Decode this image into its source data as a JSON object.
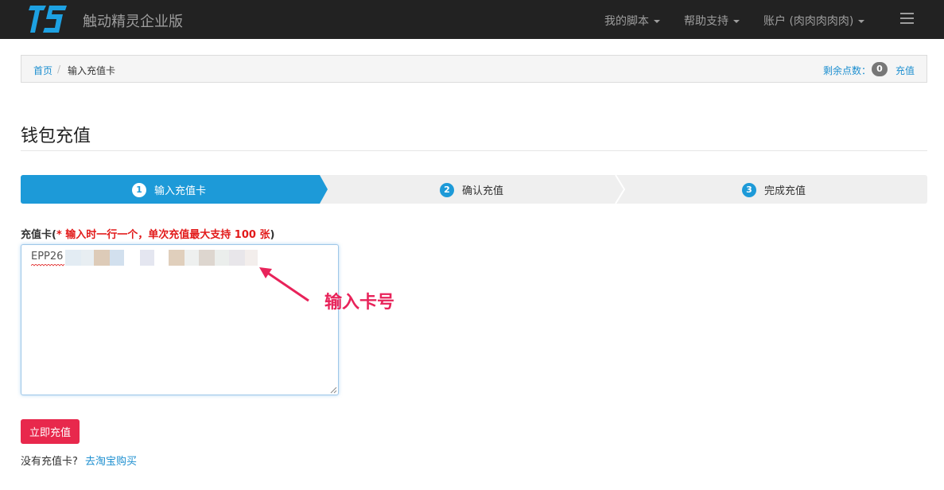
{
  "app": {
    "logo_text": "TS",
    "brand": "触动精灵企业版"
  },
  "nav": {
    "items": [
      {
        "label": "我的脚本"
      },
      {
        "label": "帮助支持"
      },
      {
        "label": "账户 (肉肉肉肉肉)"
      }
    ],
    "menu_icon": "hamburger-icon"
  },
  "breadcrumb": {
    "home": "首页",
    "separator": "/",
    "current": "输入充值卡",
    "points_label": "剩余点数：",
    "points_value": "0",
    "recharge_link": "充值"
  },
  "page": {
    "title": "钱包充值"
  },
  "steps": [
    {
      "num": "1",
      "label": "输入充值卡",
      "active": true
    },
    {
      "num": "2",
      "label": "确认充值",
      "active": false
    },
    {
      "num": "3",
      "label": "完成充值",
      "active": false
    }
  ],
  "form": {
    "label_prefix": "充值卡(",
    "label_required": "* 输入时一行一个，单次充值最大支持 100 张",
    "label_suffix": ")",
    "card_value": "EPP26",
    "submit_label": "立即充值",
    "no_card_text": "没有充值卡?",
    "buy_link": "去淘宝购买"
  },
  "annotation": {
    "text": "输入卡号"
  },
  "colors": {
    "navbar": "#222222",
    "accent": "#1d9ad8",
    "link": "#1d8fd0",
    "danger": "#e8284c",
    "annotation": "#e8235a"
  }
}
